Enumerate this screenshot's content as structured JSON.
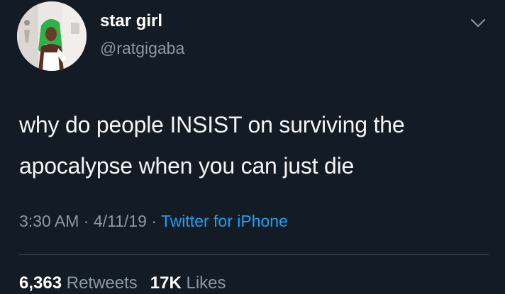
{
  "tweet": {
    "author": {
      "display_name": "star girl",
      "handle": "@ratgigaba"
    },
    "text_line1": "why do people INSIST on surviving the",
    "text_line2": "apocalypse when you can just die",
    "time": "3:30 AM",
    "date": "4/11/19",
    "separator": "·",
    "source": "Twitter for iPhone",
    "retweets_count": "6,363",
    "retweets_label": "Retweets",
    "likes_count": "17K",
    "likes_label": "Likes"
  },
  "colors": {
    "background": "#131b24",
    "secondary_text": "#8b98a5",
    "link": "#1da1f2",
    "divider": "#38444d"
  },
  "icons": {
    "menu": "chevron-down-icon",
    "avatar": "profile-photo"
  }
}
